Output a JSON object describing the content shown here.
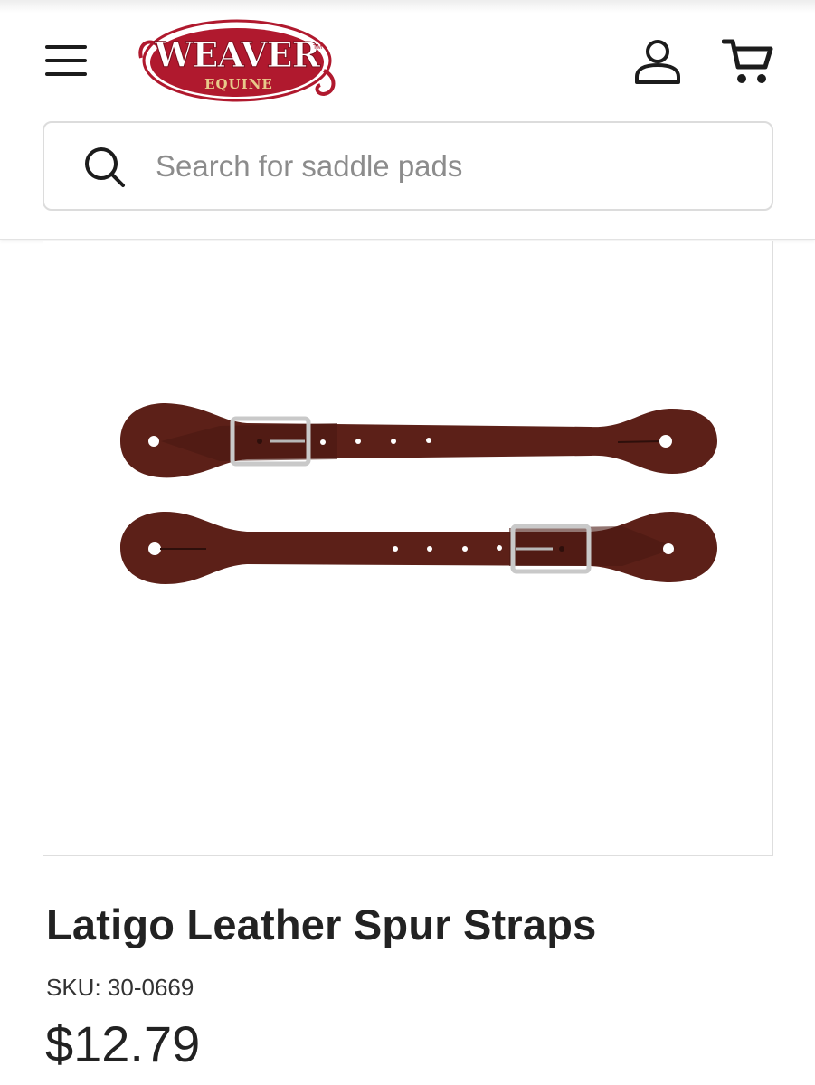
{
  "header": {
    "logo": {
      "brand": "WEAVER",
      "sub": "EQUINE",
      "tm": "TM",
      "primary_color": "#b0192e",
      "gold_color": "#e8c98a"
    },
    "icons": {
      "menu": "hamburger-menu-icon",
      "account": "user-account-icon",
      "cart": "shopping-cart-icon"
    }
  },
  "search": {
    "placeholder": "Search for saddle pads",
    "value": "",
    "icon": "search-icon"
  },
  "product": {
    "image_alt": "Latigo leather spur straps with buckles",
    "title": "Latigo Leather Spur Straps",
    "sku_label": "SKU:",
    "sku": "30-0669",
    "price": "$12.79",
    "leather_color": "#5c2018",
    "buckle_color": "#c9c9c9"
  }
}
